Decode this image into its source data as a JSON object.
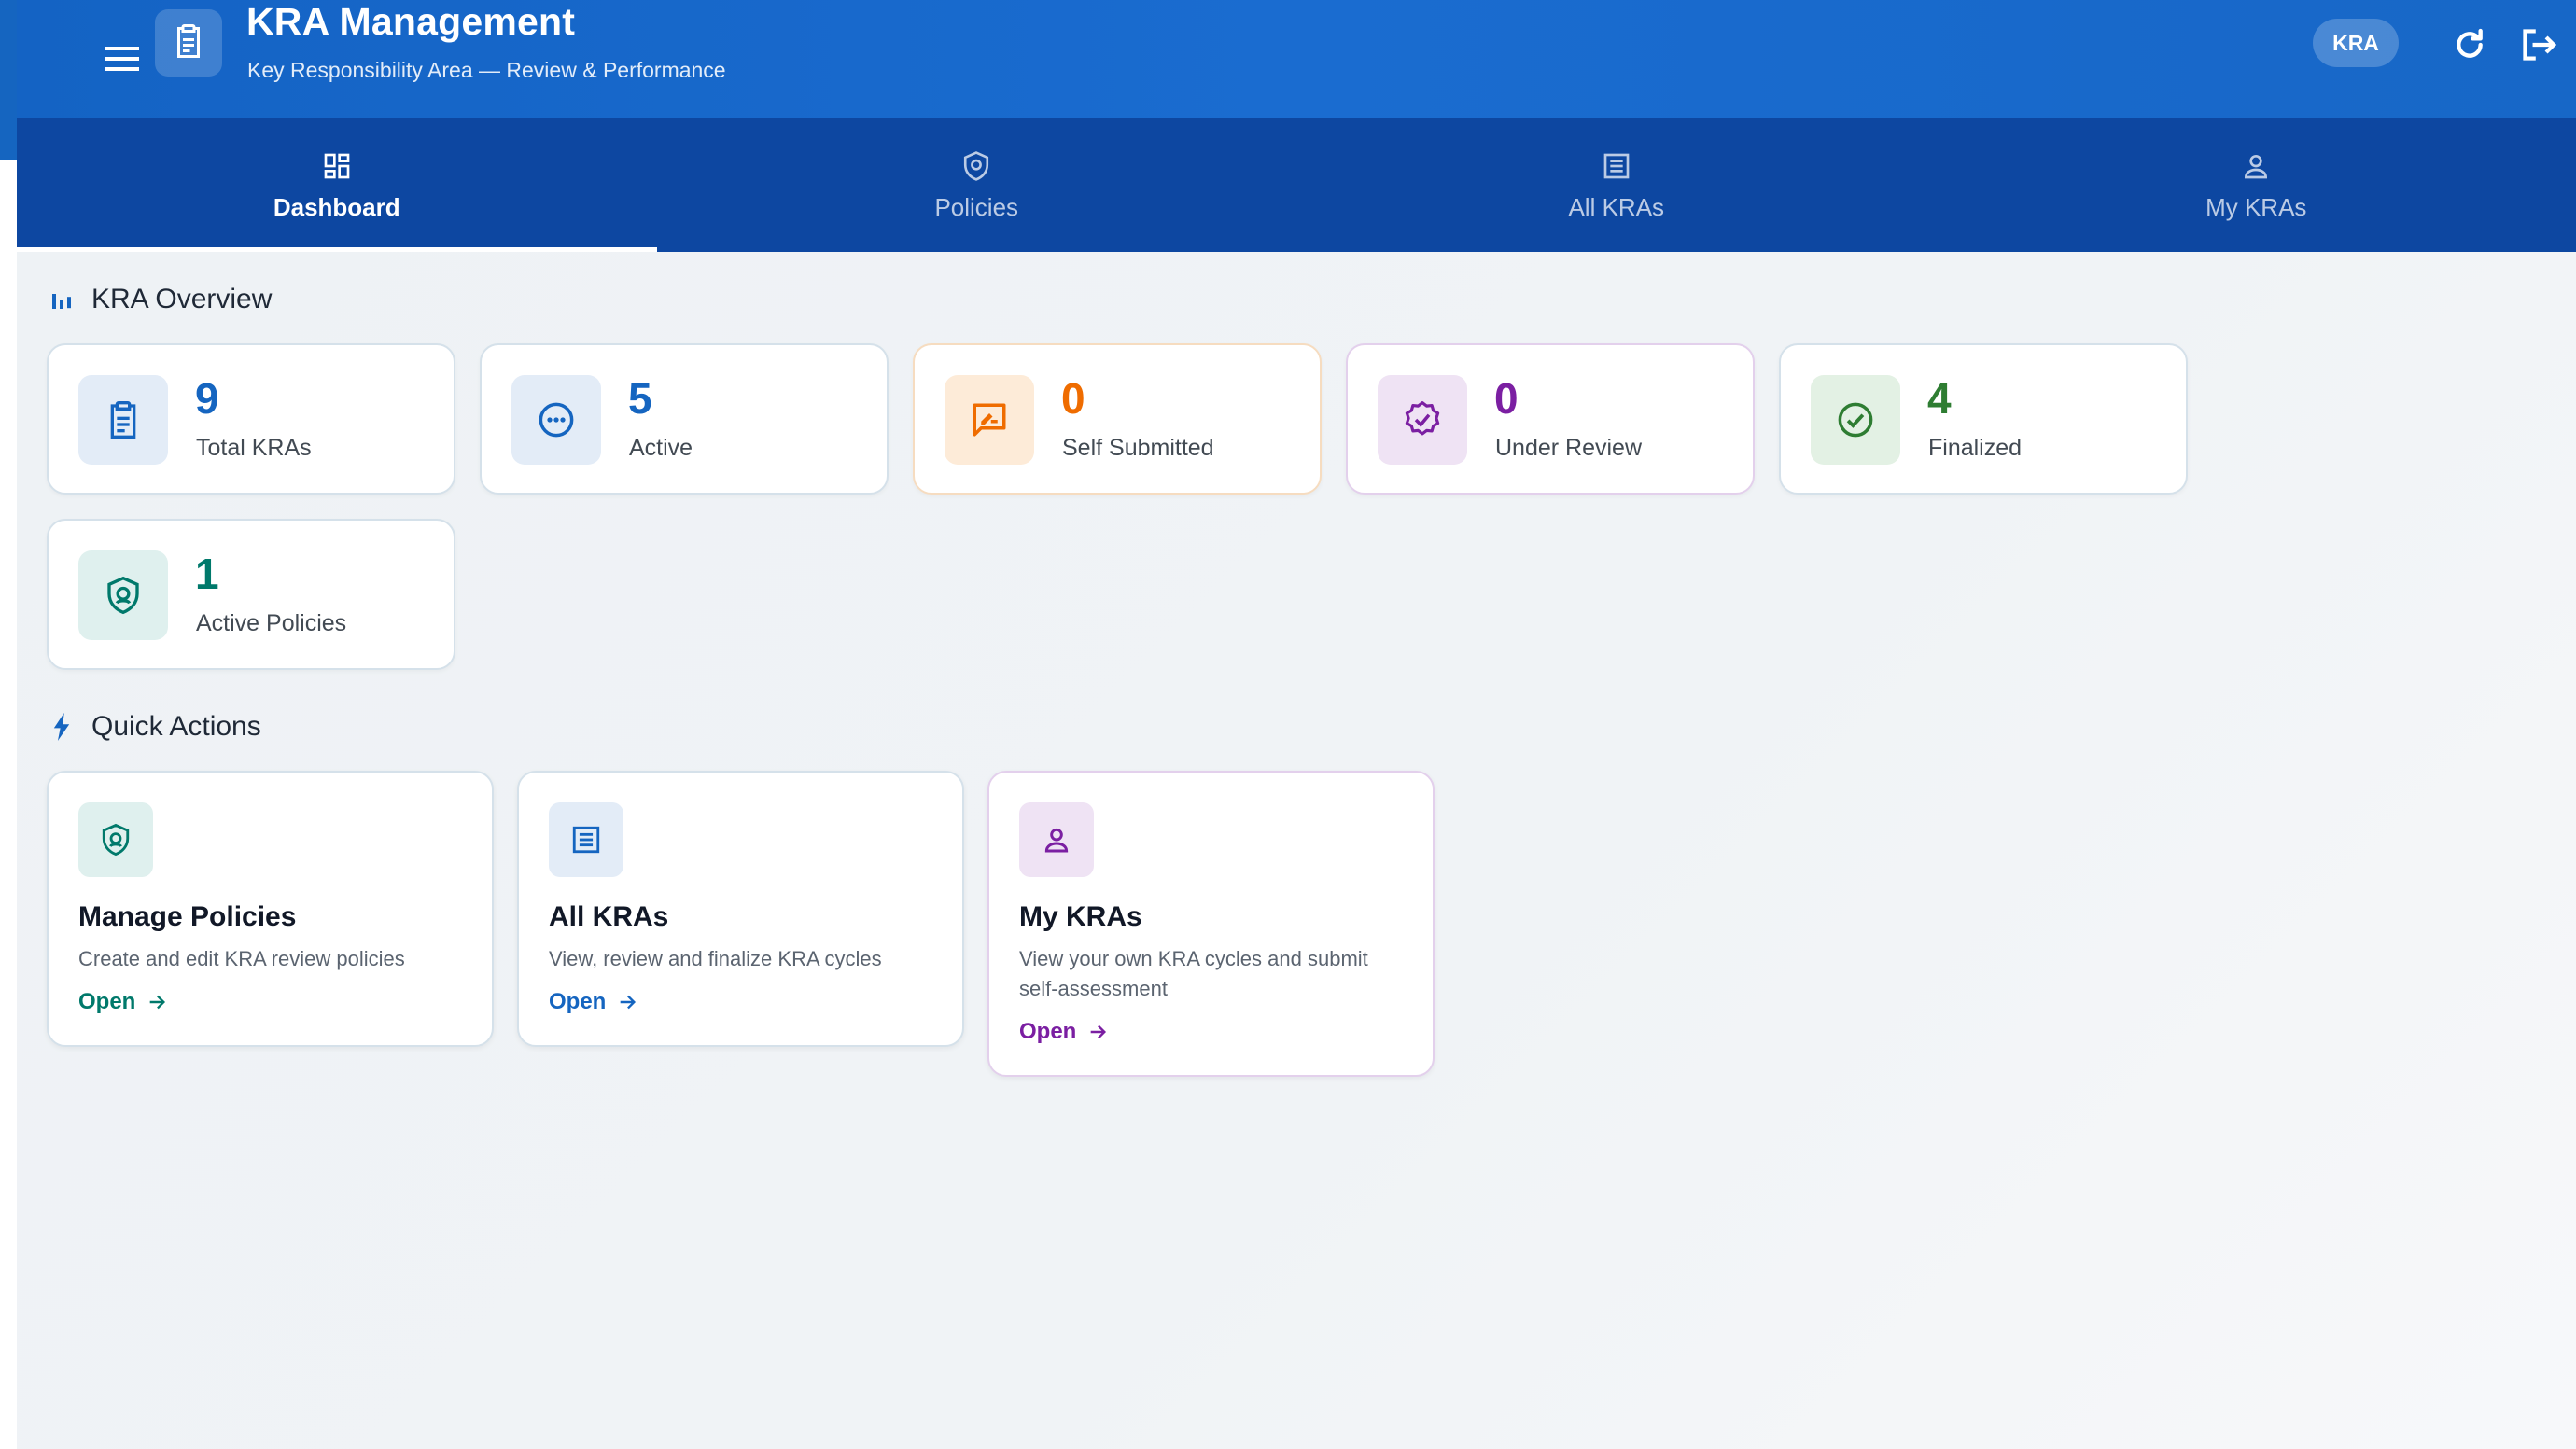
{
  "header": {
    "title": "KRA Management",
    "subtitle": "Key Responsibility Area — Review & Performance",
    "chip": "KRA",
    "icons": [
      "menu-icon",
      "clipboard-icon",
      "refresh-icon",
      "logout-icon"
    ]
  },
  "tabs": [
    {
      "label": "Dashboard",
      "icon": "dashboard-icon",
      "active": true
    },
    {
      "label": "Policies",
      "icon": "shield-icon",
      "active": false
    },
    {
      "label": "All KRAs",
      "icon": "list-icon",
      "active": false
    },
    {
      "label": "My KRAs",
      "icon": "person-icon",
      "active": false
    }
  ],
  "overview": {
    "title": "KRA Overview",
    "stats": [
      {
        "value": "9",
        "label": "Total KRAs",
        "icon": "clipboard-icon",
        "color": "#1565c0"
      },
      {
        "value": "5",
        "label": "Active",
        "icon": "pending-icon",
        "color": "#1565c0"
      },
      {
        "value": "0",
        "label": "Self Submitted",
        "icon": "rate-review-icon",
        "color": "#ef6c00"
      },
      {
        "value": "0",
        "label": "Under Review",
        "icon": "verified-icon",
        "color": "#7b1fa2"
      },
      {
        "value": "4",
        "label": "Finalized",
        "icon": "check-circle-icon",
        "color": "#2e7d32"
      },
      {
        "value": "1",
        "label": "Active Policies",
        "icon": "shield-icon",
        "color": "#00796b"
      }
    ]
  },
  "quick_actions": {
    "title": "Quick Actions",
    "cards": [
      {
        "title": "Manage Policies",
        "description": "Create and edit KRA review policies",
        "open": "Open",
        "icon": "shield-icon",
        "color": "#00796b"
      },
      {
        "title": "All KRAs",
        "description": "View, review and finalize KRA cycles",
        "open": "Open",
        "icon": "list-icon",
        "color": "#1565c0"
      },
      {
        "title": "My KRAs",
        "description": "View your own KRA cycles and submit self-assessment",
        "open": "Open",
        "icon": "person-icon",
        "color": "#7b1fa2"
      }
    ]
  }
}
